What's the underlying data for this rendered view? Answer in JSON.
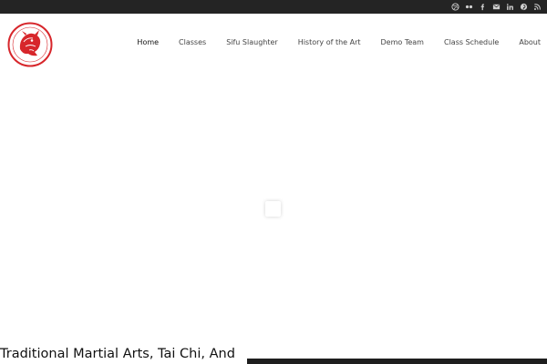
{
  "social": {
    "icons": [
      "dribbble-icon",
      "flickr-icon",
      "facebook-icon",
      "email-icon",
      "linkedin-icon",
      "pinterest-icon",
      "rss-icon"
    ]
  },
  "nav": {
    "items": [
      {
        "label": "Home",
        "active": true
      },
      {
        "label": "Classes"
      },
      {
        "label": "Sifu Slaughter"
      },
      {
        "label": "History of the Art"
      },
      {
        "label": "Demo Team"
      },
      {
        "label": "Class Schedule"
      },
      {
        "label": "About"
      }
    ]
  },
  "hero": {
    "title": "Traditional Martial Arts, Tai Chi, And"
  },
  "colors": {
    "topbar": "#242424",
    "logo_red": "#d7262b",
    "nav_text": "#444444"
  }
}
